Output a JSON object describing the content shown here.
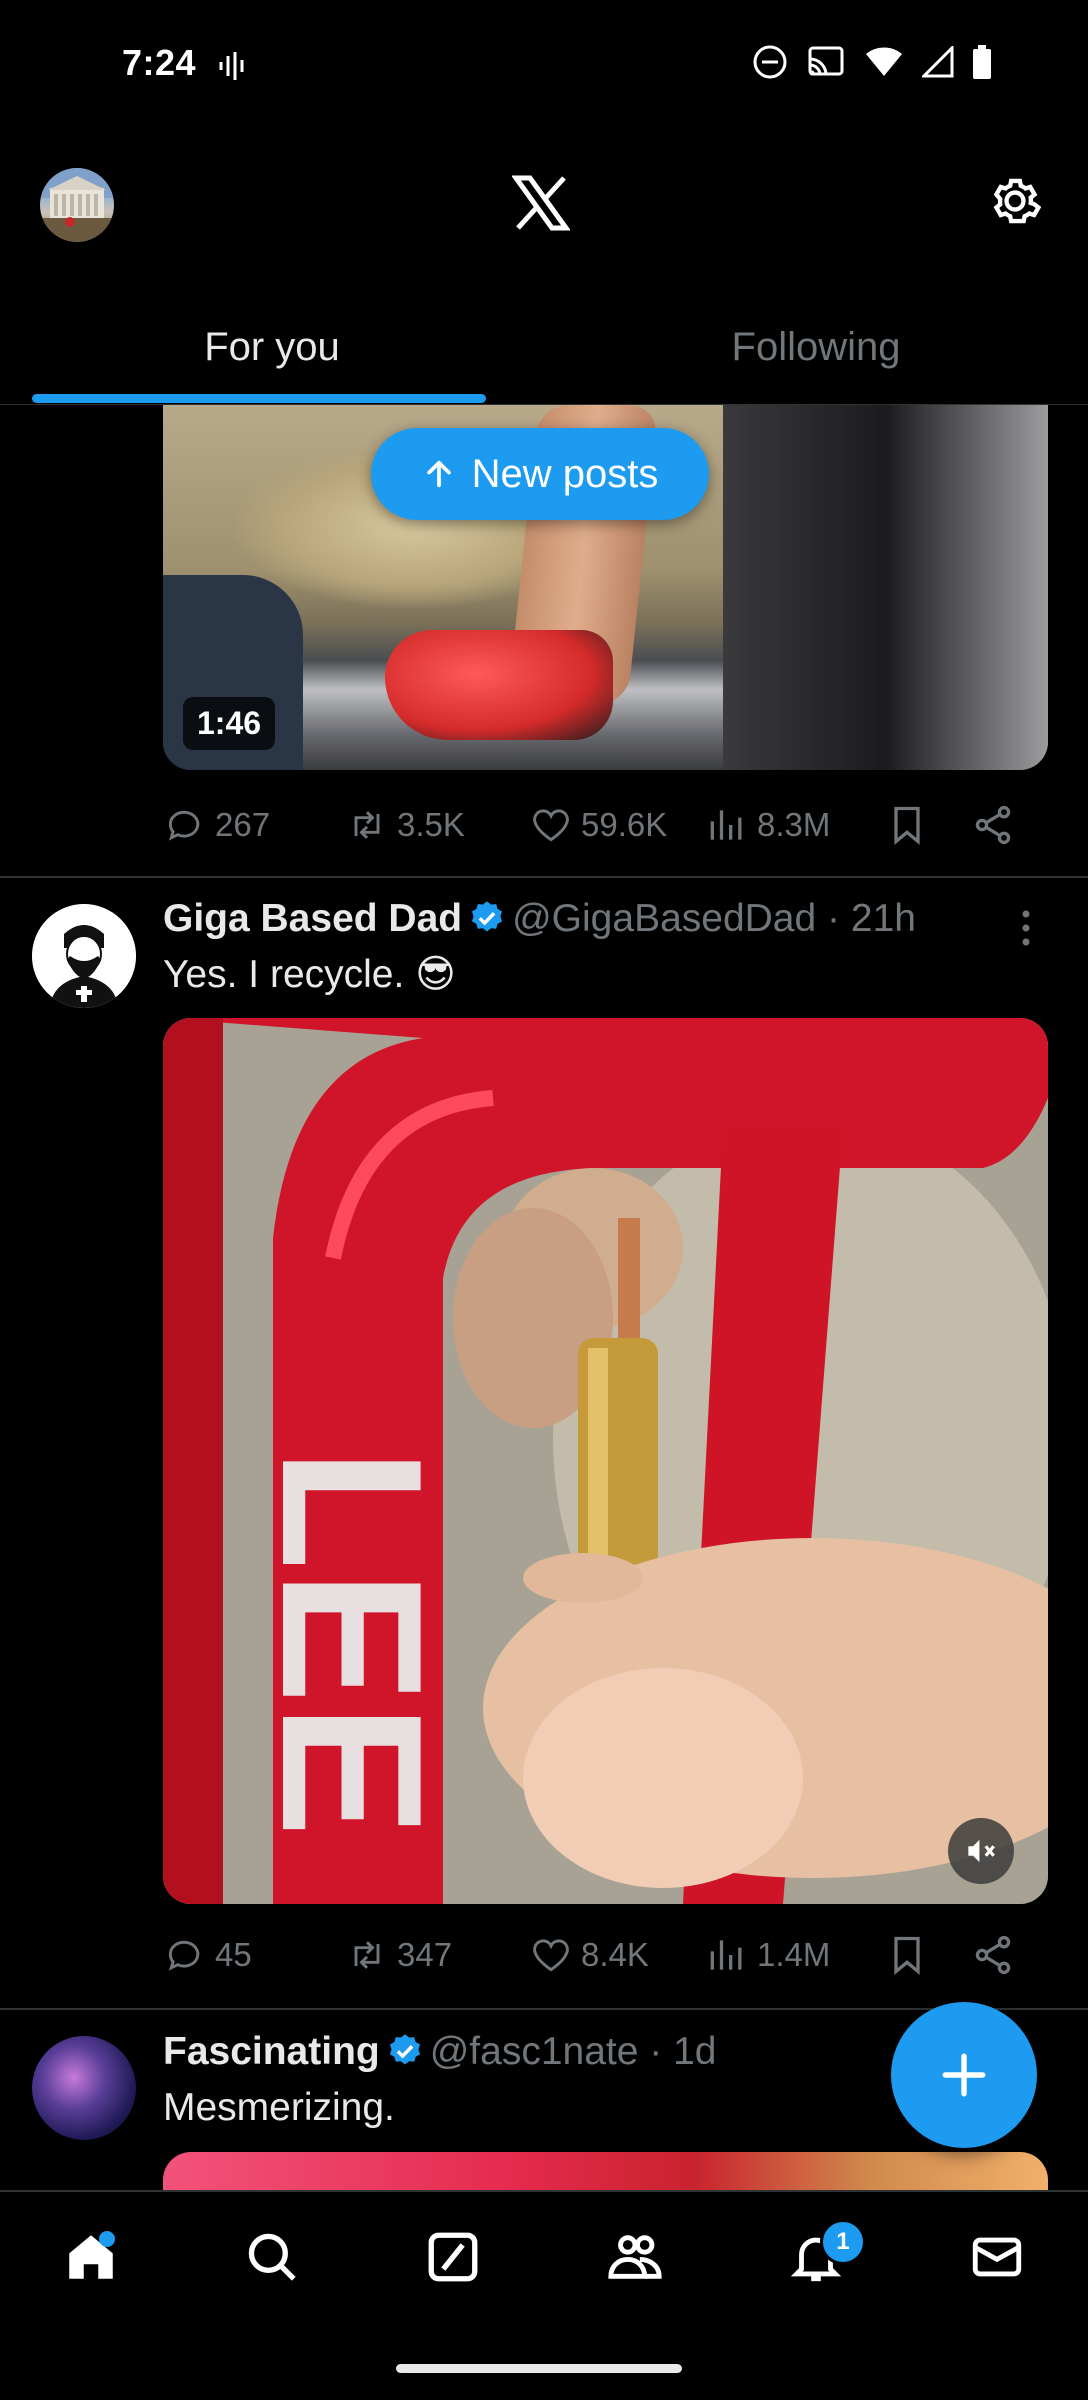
{
  "status_bar": {
    "time": "7:24"
  },
  "header": {
    "tabs": [
      {
        "label": "For you",
        "active": true
      },
      {
        "label": "Following",
        "active": false
      }
    ],
    "new_posts_label": "New posts"
  },
  "posts": [
    {
      "media_duration": "1:46",
      "stats": {
        "replies": "267",
        "reposts": "3.5K",
        "likes": "59.6K",
        "views": "8.3M"
      }
    },
    {
      "author_name": "Giga Based Dad",
      "handle": "@GigaBasedDad",
      "time": "21h",
      "text": "Yes. I recycle. 😎",
      "stats": {
        "replies": "45",
        "reposts": "347",
        "likes": "8.4K",
        "views": "1.4M"
      }
    },
    {
      "author_name": "Fascinating",
      "handle": "@fasc1nate",
      "time": "1d",
      "text": "Mesmerizing."
    }
  ],
  "bottom_nav": {
    "notifications_badge": "1"
  },
  "colors": {
    "accent": "#1d9bf0",
    "muted": "#71767b",
    "divider": "#2f3336"
  }
}
